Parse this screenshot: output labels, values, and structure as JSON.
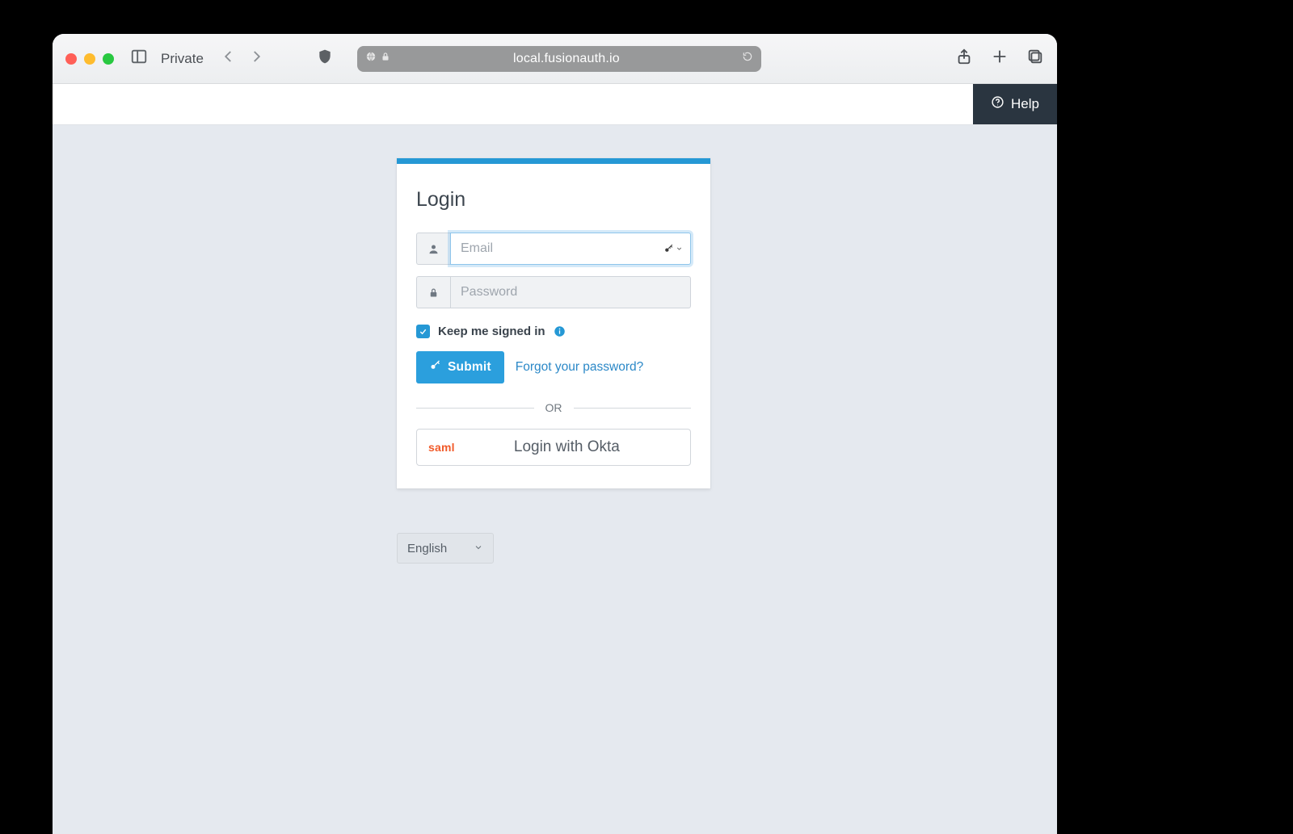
{
  "browser": {
    "private_label": "Private",
    "url": "local.fusionauth.io"
  },
  "header": {
    "help_label": "Help"
  },
  "login": {
    "title": "Login",
    "email_placeholder": "Email",
    "password_placeholder": "Password",
    "keep_signed_in_label": "Keep me signed in",
    "keep_signed_in_checked": true,
    "submit_label": "Submit",
    "forgot_label": "Forgot your password?",
    "divider_label": "OR",
    "idp": {
      "badge": "saml",
      "label": "Login with Okta"
    }
  },
  "language": {
    "selected": "English"
  },
  "colors": {
    "accent": "#2598d5",
    "idp_badge": "#f15a29",
    "header_dark": "#2a3540"
  }
}
